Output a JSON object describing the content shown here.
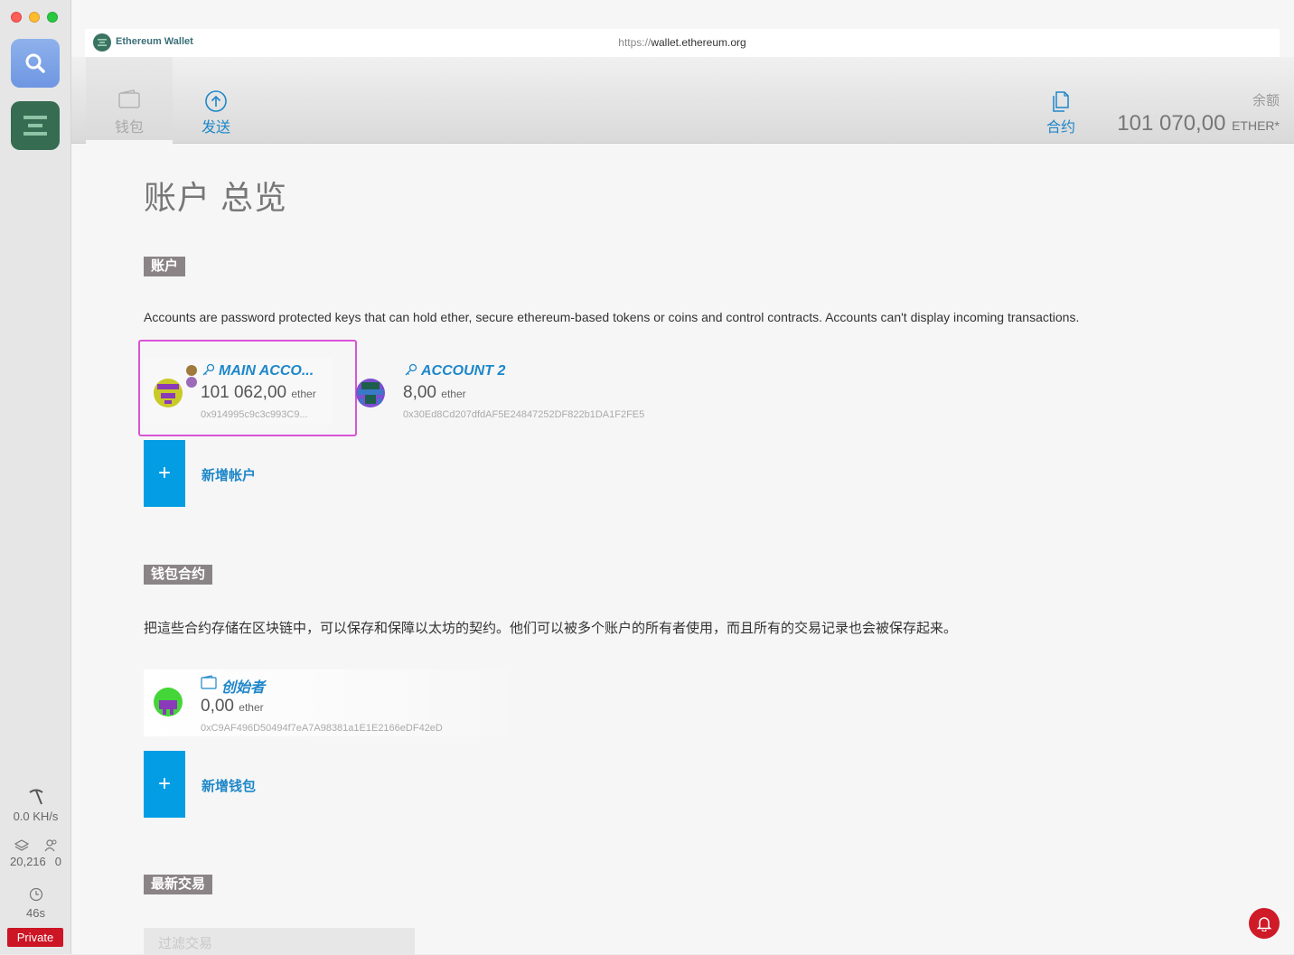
{
  "browser": {
    "app_name": "Ethereum Wallet",
    "url_protocol": "https://",
    "url_host": "wallet.ethereum.org"
  },
  "sidebar": {
    "hashrate": "0.0 KH/s",
    "block_number": "20,216",
    "peer_count": "0",
    "last_block_time": "46s",
    "network_badge": "Private"
  },
  "nav": {
    "wallet_label": "钱包",
    "send_label": "发送",
    "contracts_label": "合约",
    "balance_label": "余额",
    "balance_value": "101 070,00",
    "balance_unit": "ETHER*"
  },
  "page": {
    "title": "账户 总览"
  },
  "accounts_section": {
    "tag": "账户",
    "description": "Accounts are password protected keys that can hold ether, secure ethereum-based tokens or coins and control contracts. Accounts can't display incoming transactions.",
    "accounts": [
      {
        "name": "MAIN ACCO...",
        "balance": "101 062,00",
        "unit": "ether",
        "address": "0x914995c9c3c993C9..."
      },
      {
        "name": "ACCOUNT 2",
        "balance": "8,00",
        "unit": "ether",
        "address": "0x30Ed8Cd207dfdAF5E24847252DF822b1DA1F2FE5"
      }
    ],
    "add_label": "新增帐户",
    "add_symbol": "+"
  },
  "wallet_contracts_section": {
    "tag": "钱包合约",
    "description": "把這些合约存储在区块链中，可以保存和保障以太坊的契约。他们可以被多个账户的所有者使用，而且所有的交易记录也会被保存起来。",
    "contracts": [
      {
        "name": "创始者",
        "balance": "0,00",
        "unit": "ether",
        "address": "0xC9AF496D50494f7eA7A98381a1E1E2166eDF42eD"
      }
    ],
    "add_label": "新增钱包",
    "add_symbol": "+"
  },
  "transactions_section": {
    "tag": "最新交易",
    "filter_placeholder": "过滤交易"
  },
  "colors": {
    "accent_blue": "#1e87c9",
    "add_button_blue": "#039de4",
    "private_red": "#cc1525",
    "highlight_magenta": "#d855d6"
  }
}
